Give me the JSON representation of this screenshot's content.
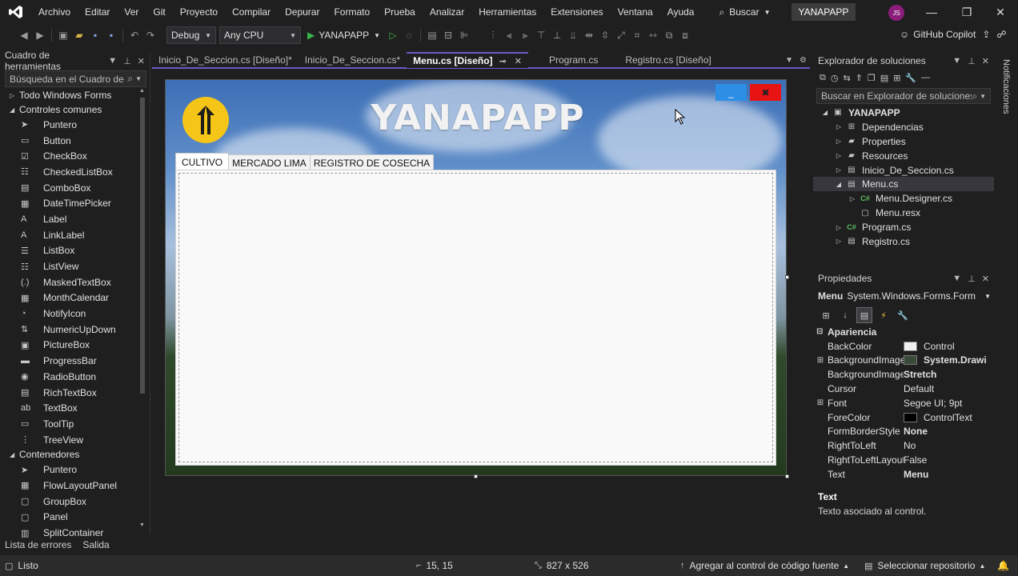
{
  "menubar": {
    "items": [
      "Archivo",
      "Editar",
      "Ver",
      "Git",
      "Proyecto",
      "Compilar",
      "Depurar",
      "Formato",
      "Prueba",
      "Analizar",
      "Herramientas",
      "Extensiones",
      "Ventana",
      "Ayuda"
    ],
    "search_label": "Buscar",
    "solution_badge": "YANAPAPP",
    "user_initials": "JS"
  },
  "toolbar": {
    "configuration": "Debug",
    "platform": "Any CPU",
    "run_target": "YANAPAPP",
    "copilot_label": "GitHub Copilot"
  },
  "toolbox": {
    "title": "Cuadro de herramientas",
    "search_placeholder": "Búsqueda en el Cuadro de h",
    "groups": [
      {
        "label": "Todo Windows Forms",
        "expanded": false
      },
      {
        "label": "Controles comunes",
        "expanded": true
      },
      {
        "label": "Contenedores",
        "expanded": true
      }
    ],
    "common_items": [
      {
        "label": "Puntero",
        "icon": "pointer-icon",
        "glyph": "➤"
      },
      {
        "label": "Button",
        "icon": "button-icon",
        "glyph": "▭"
      },
      {
        "label": "CheckBox",
        "icon": "checkbox-icon",
        "glyph": "☑"
      },
      {
        "label": "CheckedListBox",
        "icon": "checkedlistbox-icon",
        "glyph": "☷"
      },
      {
        "label": "ComboBox",
        "icon": "combobox-icon",
        "glyph": "▤"
      },
      {
        "label": "DateTimePicker",
        "icon": "datetimepicker-icon",
        "glyph": "▦"
      },
      {
        "label": "Label",
        "icon": "label-icon",
        "glyph": "A"
      },
      {
        "label": "LinkLabel",
        "icon": "linklabel-icon",
        "glyph": "A"
      },
      {
        "label": "ListBox",
        "icon": "listbox-icon",
        "glyph": "☰"
      },
      {
        "label": "ListView",
        "icon": "listview-icon",
        "glyph": "☷"
      },
      {
        "label": "MaskedTextBox",
        "icon": "maskedtextbox-icon",
        "glyph": "(.)"
      },
      {
        "label": "MonthCalendar",
        "icon": "monthcalendar-icon",
        "glyph": "▦"
      },
      {
        "label": "NotifyIcon",
        "icon": "notifyicon-icon",
        "glyph": "◔"
      },
      {
        "label": "NumericUpDown",
        "icon": "numericupdown-icon",
        "glyph": "⇅"
      },
      {
        "label": "PictureBox",
        "icon": "picturebox-icon",
        "glyph": "▣"
      },
      {
        "label": "ProgressBar",
        "icon": "progressbar-icon",
        "glyph": "▬"
      },
      {
        "label": "RadioButton",
        "icon": "radiobutton-icon",
        "glyph": "◉"
      },
      {
        "label": "RichTextBox",
        "icon": "richtextbox-icon",
        "glyph": "▤"
      },
      {
        "label": "TextBox",
        "icon": "textbox-icon",
        "glyph": "ab"
      },
      {
        "label": "ToolTip",
        "icon": "tooltip-icon",
        "glyph": "▭"
      },
      {
        "label": "TreeView",
        "icon": "treeview-icon",
        "glyph": "⋮"
      }
    ],
    "container_items": [
      {
        "label": "Puntero",
        "icon": "pointer-icon",
        "glyph": "➤"
      },
      {
        "label": "FlowLayoutPanel",
        "icon": "flowlayoutpanel-icon",
        "glyph": "▦"
      },
      {
        "label": "GroupBox",
        "icon": "groupbox-icon",
        "glyph": "▢"
      },
      {
        "label": "Panel",
        "icon": "panel-icon",
        "glyph": "▢"
      },
      {
        "label": "SplitContainer",
        "icon": "splitcontainer-icon",
        "glyph": "▥"
      }
    ]
  },
  "doc_tabs": [
    {
      "label": "Inicio_De_Seccion.cs [Diseño]*",
      "active": false
    },
    {
      "label": "Inicio_De_Seccion.cs*",
      "active": false
    },
    {
      "label": "Menu.cs [Diseño]",
      "active": true
    },
    {
      "label": "Program.cs",
      "active": false
    },
    {
      "label": "Registro.cs [Diseño]",
      "active": false
    }
  ],
  "form": {
    "title": "YANAPAPP",
    "minimize_label": "_",
    "close_label": "✖",
    "tabs": [
      "CULTIVO",
      "MERCADO LIMA",
      "REGISTRO DE COSECHA"
    ],
    "selected_tab": "CULTIVO"
  },
  "solution_explorer": {
    "title": "Explorador de soluciones",
    "search_placeholder": "Buscar en Explorador de soluciones (C",
    "tree": [
      {
        "label": "YANAPAPP",
        "level": 0,
        "caret": "◢",
        "icon": "csharp-project-icon",
        "glyph": "▣",
        "bold": true
      },
      {
        "label": "Dependencias",
        "level": 1,
        "caret": "▷",
        "icon": "dependencies-icon",
        "glyph": "⊞"
      },
      {
        "label": "Properties",
        "level": 1,
        "caret": "▷",
        "icon": "properties-folder-icon",
        "glyph": "▰"
      },
      {
        "label": "Resources",
        "level": 1,
        "caret": "▷",
        "icon": "folder-icon",
        "glyph": "▰"
      },
      {
        "label": "Inicio_De_Seccion.cs",
        "level": 1,
        "caret": "▷",
        "icon": "form-file-icon",
        "glyph": "▤"
      },
      {
        "label": "Menu.cs",
        "level": 1,
        "caret": "◢",
        "icon": "form-file-icon",
        "glyph": "▤",
        "selected": true
      },
      {
        "label": "Menu.Designer.cs",
        "level": 2,
        "caret": "▷",
        "icon": "csharp-file-icon",
        "glyph": "C#"
      },
      {
        "label": "Menu.resx",
        "level": 2,
        "caret": "",
        "icon": "resx-file-icon",
        "glyph": "▢"
      },
      {
        "label": "Program.cs",
        "level": 1,
        "caret": "▷",
        "icon": "csharp-file-icon",
        "glyph": "C#"
      },
      {
        "label": "Registro.cs",
        "level": 1,
        "caret": "▷",
        "icon": "form-file-icon",
        "glyph": "▤"
      }
    ]
  },
  "side_strip": {
    "label": "Notificaciones"
  },
  "properties": {
    "title": "Propiedades",
    "object_name": "Menu",
    "object_type": "System.Windows.Forms.Form",
    "category": "Apariencia",
    "rows": [
      {
        "name": "BackColor",
        "value": "Control",
        "swatch": "#f0f0f0",
        "expand": ""
      },
      {
        "name": "BackgroundImage",
        "value": "System.Drawi",
        "swatch": "#3a4a3a",
        "bold": true,
        "expand": "⊞"
      },
      {
        "name": "BackgroundImage",
        "value": "Stretch",
        "bold": true,
        "expand": ""
      },
      {
        "name": "Cursor",
        "value": "Default",
        "expand": ""
      },
      {
        "name": "Font",
        "value": "Segoe UI; 9pt",
        "expand": "⊞"
      },
      {
        "name": "ForeColor",
        "value": "ControlText",
        "swatch": "#000000",
        "expand": ""
      },
      {
        "name": "FormBorderStyle",
        "value": "None",
        "bold": true,
        "expand": ""
      },
      {
        "name": "RightToLeft",
        "value": "No",
        "expand": ""
      },
      {
        "name": "RightToLeftLayout",
        "value": "False",
        "expand": ""
      },
      {
        "name": "Text",
        "value": "Menu",
        "bold": true,
        "expand": ""
      }
    ],
    "desc_title": "Text",
    "desc_text": "Texto asociado al control."
  },
  "bottom_tabs": [
    "Lista de errores",
    "Salida"
  ],
  "statusbar": {
    "ready": "Listo",
    "position": "15, 15",
    "size": "827 x 526",
    "source_control": "Agregar al control de código fuente",
    "repository": "Seleccionar repositorio"
  }
}
